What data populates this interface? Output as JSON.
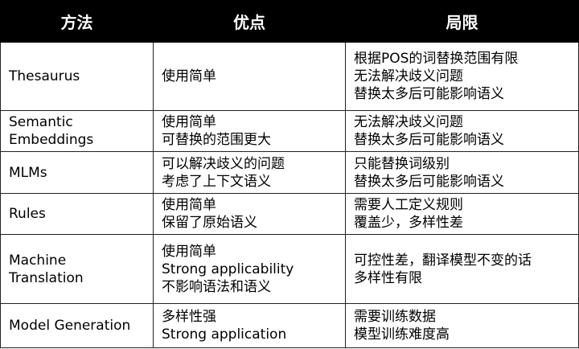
{
  "header": {
    "method": "方法",
    "advantages": "优点",
    "limitations": "局限"
  },
  "rows": [
    {
      "method": [
        "Thesaurus"
      ],
      "advantages": [
        "使用简单"
      ],
      "limitations": [
        "根据POS的词替换范围有限",
        "无法解决歧义问题",
        "替换太多后可能影响语义"
      ]
    },
    {
      "method": [
        "Semantic",
        "Embeddings"
      ],
      "advantages": [
        "使用简单",
        "可替换的范围更大"
      ],
      "limitations": [
        "无法解决歧义问题",
        "替换太多后可能影响语义"
      ]
    },
    {
      "method": [
        "MLMs"
      ],
      "advantages": [
        "可以解决歧义的问题",
        "考虑了上下文语义"
      ],
      "limitations": [
        "只能替换词级别",
        "替换太多后可能影响语义"
      ]
    },
    {
      "method": [
        "Rules"
      ],
      "advantages": [
        "使用简单",
        "保留了原始语义"
      ],
      "limitations": [
        "需要人工定义规则",
        "覆盖少，多样性差"
      ]
    },
    {
      "method": [
        "Machine",
        "Translation"
      ],
      "advantages": [
        "使用简单",
        "Strong applicability",
        "不影响语法和语义"
      ],
      "limitations": [
        "可控性差，翻译模型不变的话",
        "多样性有限"
      ]
    },
    {
      "method": [
        "Model Generation"
      ],
      "advantages": [
        "多样性强",
        "Strong application"
      ],
      "limitations": [
        "需要训练数据",
        "模型训练难度高"
      ]
    }
  ]
}
